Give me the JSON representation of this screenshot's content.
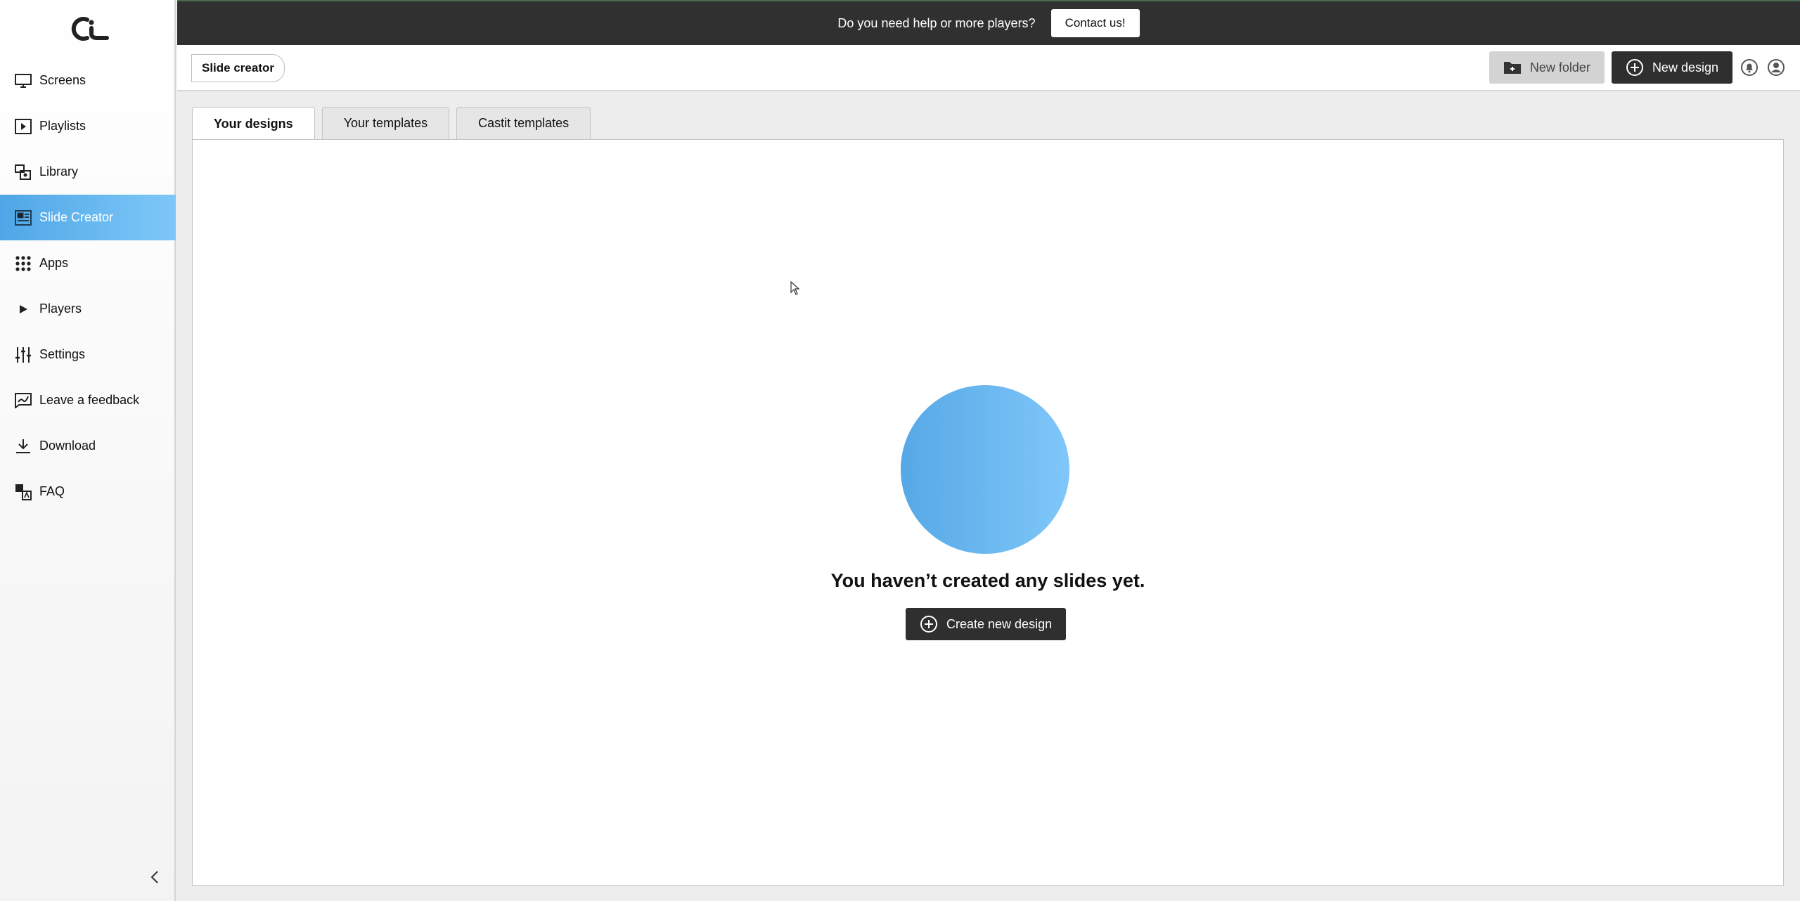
{
  "banner": {
    "text": "Do you need help or more players?",
    "contact_label": "Contact us!"
  },
  "sidebar": {
    "logo": "castit-logo",
    "items": [
      {
        "label": "Screens",
        "icon": "monitor-icon"
      },
      {
        "label": "Playlists",
        "icon": "playlist-icon"
      },
      {
        "label": "Library",
        "icon": "library-icon"
      },
      {
        "label": "Slide Creator",
        "icon": "slide-creator-icon",
        "active": true
      },
      {
        "label": "Apps",
        "icon": "grid-icon"
      },
      {
        "label": "Players",
        "icon": "play-icon"
      },
      {
        "label": "Settings",
        "icon": "sliders-icon"
      },
      {
        "label": "Leave a feedback",
        "icon": "feedback-icon"
      },
      {
        "label": "Download",
        "icon": "download-icon"
      },
      {
        "label": "FAQ",
        "icon": "faq-icon"
      }
    ],
    "collapse_icon": "chevron-left-icon"
  },
  "header": {
    "breadcrumb": "Slide creator",
    "new_folder_label": "New folder",
    "new_design_label": "New design",
    "notification_icon": "bell-icon",
    "account_icon": "user-icon"
  },
  "tabs": [
    {
      "label": "Your designs",
      "active": true
    },
    {
      "label": "Your templates"
    },
    {
      "label": "Castit templates"
    }
  ],
  "empty_state": {
    "title": "You haven’t created any slides yet.",
    "button_label": "Create new design"
  },
  "colors": {
    "accent_start": "#4fa6e6",
    "accent_end": "#7ec8f8",
    "dark": "#2f2f2f"
  }
}
